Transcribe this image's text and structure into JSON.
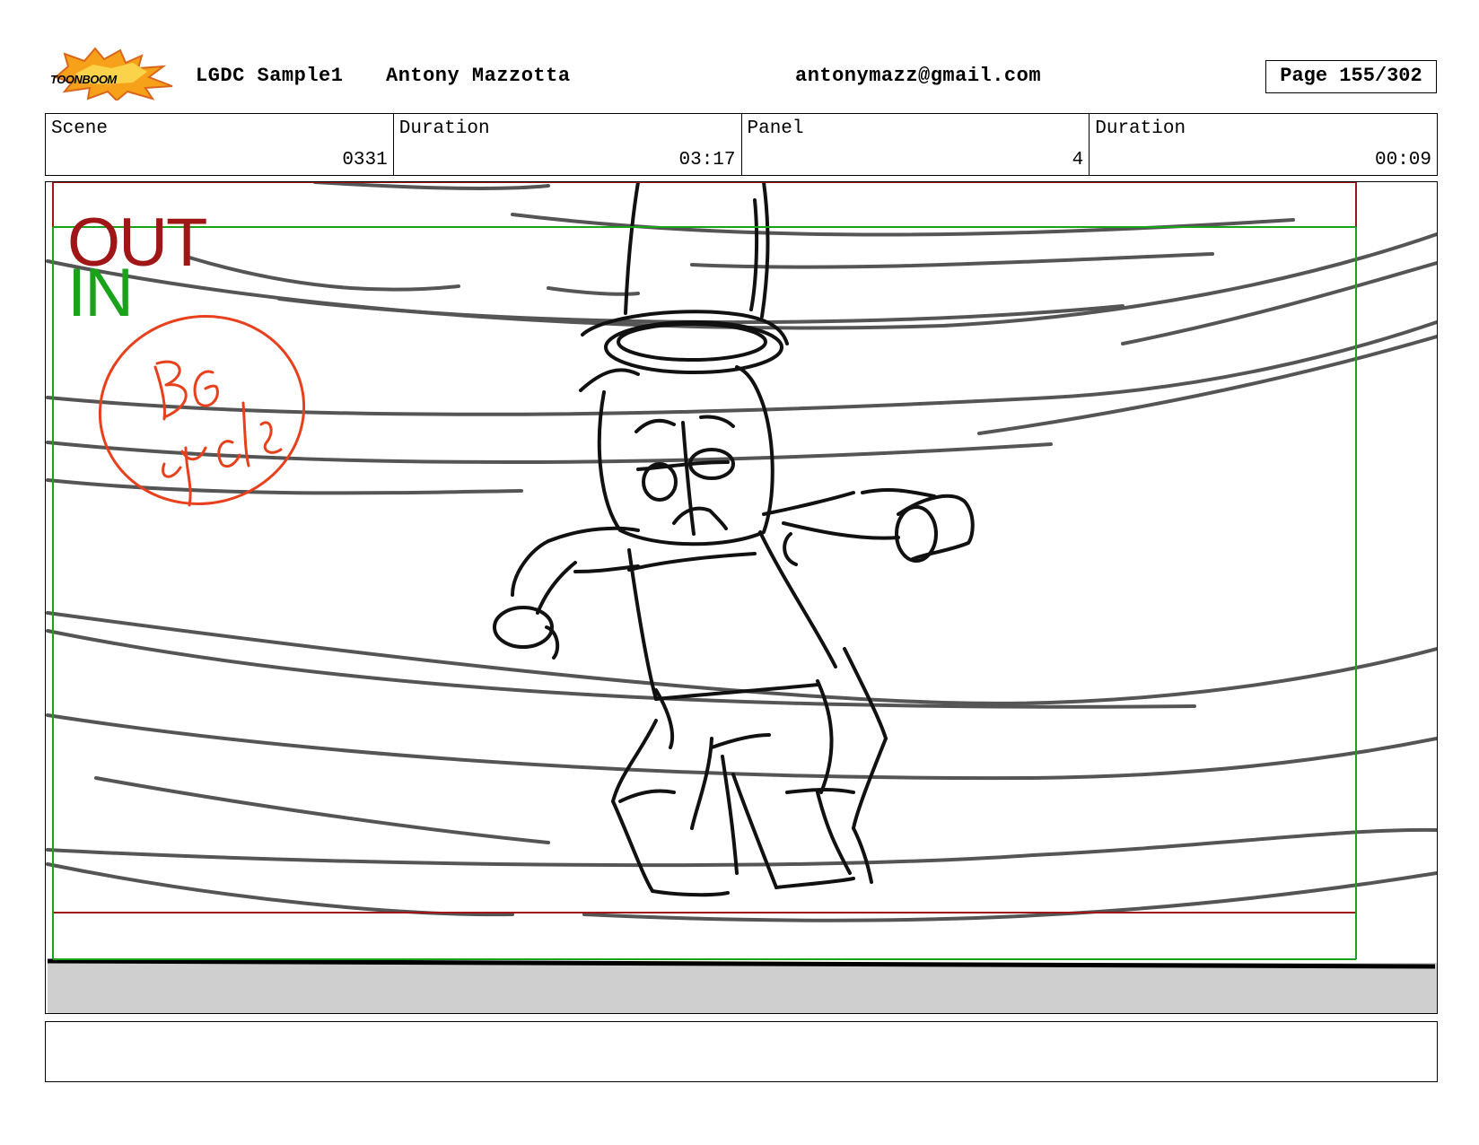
{
  "header": {
    "logo_text": "TOONBOOM",
    "project": "LGDC Sample1",
    "author": "Antony Mazzotta",
    "email": "antonymazz@gmail.com",
    "page": "Page 155/302"
  },
  "info": {
    "scene_label": "Scene",
    "scene_value": "0331",
    "scene_duration_label": "Duration",
    "scene_duration_value": "03:17",
    "panel_label": "Panel",
    "panel_value": "4",
    "panel_duration_label": "Duration",
    "panel_duration_value": "00:09"
  },
  "panel": {
    "out_label": "OUT",
    "in_label": "IN",
    "note_text": "BG cycle",
    "colors": {
      "out": "#a01515",
      "in": "#1aa31a",
      "note": "#e8401c"
    }
  },
  "caption": {
    "text": ""
  }
}
